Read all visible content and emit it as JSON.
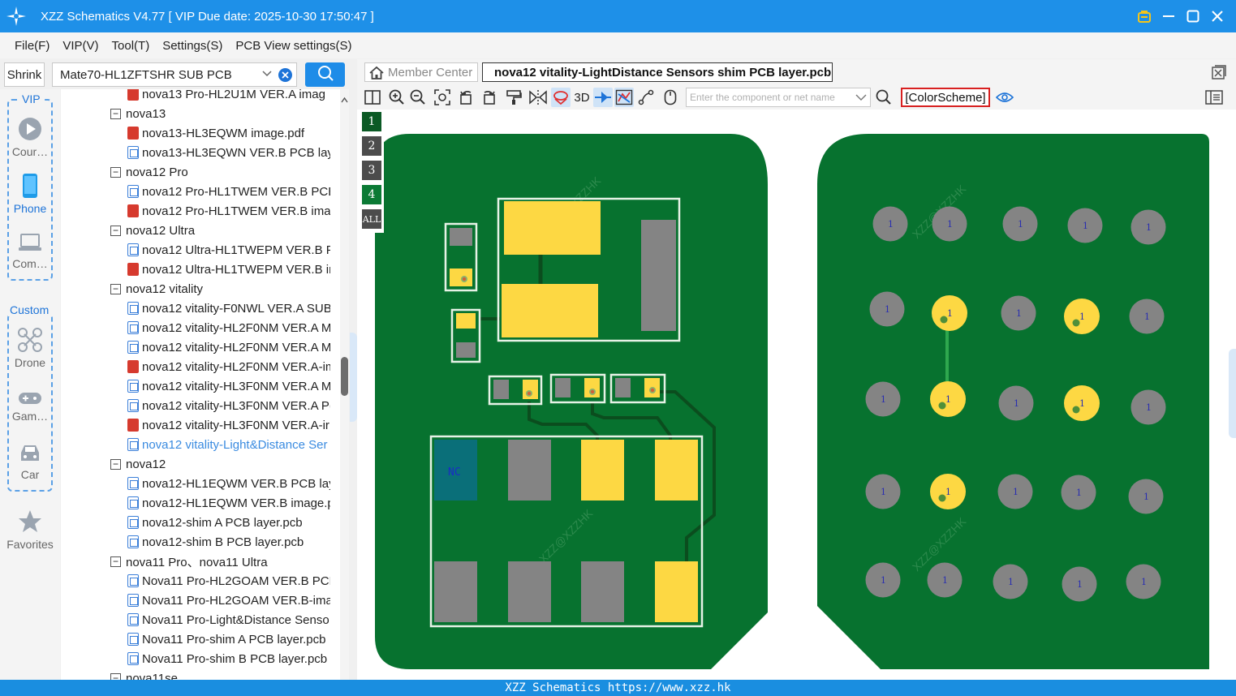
{
  "app": {
    "title": "XZZ Schematics V4.77 [ VIP Due date: 2025-10-30 17:50:47 ]"
  },
  "menu": [
    "File(F)",
    "VIP(V)",
    "Tool(T)",
    "Settings(S)",
    "PCB View settings(S)"
  ],
  "left_search": {
    "shrink_label": "Shrink",
    "selected_pcb": "Mate70-HL1ZFTSHR SUB PCB"
  },
  "rail": {
    "vip_label": "VIP",
    "custom_label": "Custom",
    "items": [
      {
        "label": "Cour…",
        "icon": "play-icon"
      },
      {
        "label": "Phone",
        "icon": "phone-icon"
      },
      {
        "label": "Com…",
        "icon": "laptop-icon"
      },
      {
        "label": "Drone",
        "icon": "drone-icon"
      },
      {
        "label": "Gam…",
        "icon": "gamepad-icon"
      },
      {
        "label": "Car",
        "icon": "car-icon"
      },
      {
        "label": "Favorites",
        "icon": "star-icon"
      }
    ]
  },
  "tree": [
    {
      "level": 1,
      "type": "pdf",
      "label": "nova13 Pro-HL2U1M VER.A imag"
    },
    {
      "level": 0,
      "type": "folder",
      "label": "nova13"
    },
    {
      "level": 1,
      "type": "pdf",
      "label": "nova13-HL3EQWM image.pdf"
    },
    {
      "level": 1,
      "type": "pcb",
      "label": "nova13-HL3EQWN VER.B PCB layer"
    },
    {
      "level": 0,
      "type": "folder",
      "label": "nova12 Pro"
    },
    {
      "level": 1,
      "type": "pcb",
      "label": "nova12 Pro-HL1TWEM VER.B PCB l"
    },
    {
      "level": 1,
      "type": "pdf",
      "label": "nova12 Pro-HL1TWEM VER.B imag"
    },
    {
      "level": 0,
      "type": "folder",
      "label": "nova12 Ultra"
    },
    {
      "level": 1,
      "type": "pcb",
      "label": "nova12 Ultra-HL1TWEPM VER.B PC"
    },
    {
      "level": 1,
      "type": "pdf",
      "label": "nova12 Ultra-HL1TWEPM VER.B im"
    },
    {
      "level": 0,
      "type": "folder",
      "label": "nova12 vitality"
    },
    {
      "level": 1,
      "type": "pcb",
      "label": "nova12 vitality-F0NWL VER.A SUB I"
    },
    {
      "level": 1,
      "type": "pcb",
      "label": "nova12 vitality-HL2F0NM VER.A M"
    },
    {
      "level": 1,
      "type": "pcb",
      "label": "nova12 vitality-HL2F0NM VER.A M"
    },
    {
      "level": 1,
      "type": "pdf",
      "label": "nova12 vitality-HL2F0NM VER.A-im"
    },
    {
      "level": 1,
      "type": "pcb",
      "label": "nova12 vitality-HL3F0NM VER.A M"
    },
    {
      "level": 1,
      "type": "pcb",
      "label": "nova12 vitality-HL3F0NM VER.A P("
    },
    {
      "level": 1,
      "type": "pdf",
      "label": "nova12 vitality-HL3F0NM VER.A-ir"
    },
    {
      "level": 1,
      "type": "pcb",
      "label": "nova12 vitality-Light&Distance Ser",
      "selected": true
    },
    {
      "level": 0,
      "type": "folder",
      "label": "nova12"
    },
    {
      "level": 1,
      "type": "pcb",
      "label": "nova12-HL1EQWM VER.B PCB laye"
    },
    {
      "level": 1,
      "type": "pcb",
      "label": "nova12-HL1EQWM VER.B image.p("
    },
    {
      "level": 1,
      "type": "pcb",
      "label": "nova12-shim A PCB layer.pcb"
    },
    {
      "level": 1,
      "type": "pcb",
      "label": "nova12-shim B PCB layer.pcb"
    },
    {
      "level": 0,
      "type": "folder",
      "label": "nova11 Pro、nova11 Ultra"
    },
    {
      "level": 1,
      "type": "pcb",
      "label": "Nova11 Pro-HL2GOAM VER.B PCB"
    },
    {
      "level": 1,
      "type": "pcb",
      "label": "Nova11 Pro-HL2GOAM VER.B-imag"
    },
    {
      "level": 1,
      "type": "pcb",
      "label": "Nova11 Pro-Light&Distance Senso"
    },
    {
      "level": 1,
      "type": "pcb",
      "label": "Nova11 Pro-shim A PCB layer.pcb"
    },
    {
      "level": 1,
      "type": "pcb",
      "label": "Nova11 Pro-shim B PCB layer.pcb"
    },
    {
      "level": 0,
      "type": "folder",
      "label": "nova11se"
    }
  ],
  "tabs": {
    "member_center": "Member Center",
    "active_doc": "nova12 vitality-LightDistance Sensors shim PCB layer.pcb"
  },
  "toolbar": {
    "three_d_label": "3D",
    "search_placeholder": "Enter the component or net name",
    "color_scheme_label": "[ColorScheme]"
  },
  "layers": [
    {
      "label": "1",
      "active": true
    },
    {
      "label": "2",
      "active": false
    },
    {
      "label": "3",
      "active": false
    },
    {
      "label": "4",
      "active": true
    },
    {
      "label": "ALL",
      "active": false
    }
  ],
  "pcb": {
    "nc_label": "NC",
    "pad_label": "1",
    "watermark": "XZZ@XZZHK",
    "colors": {
      "board": "#07722f",
      "pad_yellow": "#fdd843",
      "pad_gray": "#848484",
      "trace": "#0b4d1e",
      "nc_pad": "#0a6f79"
    }
  },
  "statusbar": {
    "text": "XZZ Schematics https://www.xzz.hk"
  }
}
